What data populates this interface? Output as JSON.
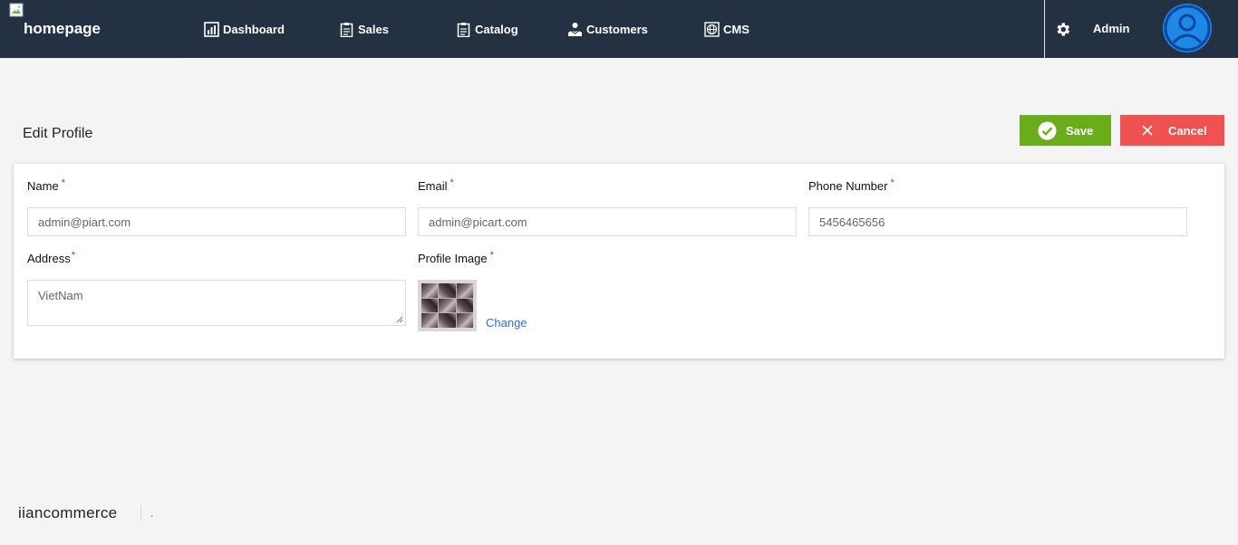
{
  "nav": {
    "brand": "homepage",
    "items": [
      {
        "label": "Dashboard",
        "icon": "dashboard-icon"
      },
      {
        "label": "Sales",
        "icon": "clipboard-icon"
      },
      {
        "label": "Catalog",
        "icon": "clipboard-icon"
      },
      {
        "label": "Customers",
        "icon": "customers-icon"
      },
      {
        "label": "CMS",
        "icon": "globe-icon"
      }
    ],
    "settings_icon": "gear-icon",
    "user_name": "Admin",
    "avatar_icon": "user-avatar-icon"
  },
  "page": {
    "title": "Edit Profile",
    "save_label": "Save",
    "cancel_label": "Cancel"
  },
  "form": {
    "name": {
      "label": "Name",
      "required": "*",
      "value": "admin@piart.com"
    },
    "email": {
      "label": "Email",
      "required": "*",
      "value": "admin@picart.com"
    },
    "phone": {
      "label": "Phone Number",
      "required": "*",
      "value": "5456465656"
    },
    "address": {
      "label": "Address",
      "required": "*",
      "value": "VietNam"
    },
    "profile_image": {
      "label": "Profile Image",
      "required": "*",
      "change_label": "Change"
    }
  },
  "footer": {
    "brand": "iiancommerce",
    "dot": "."
  },
  "colors": {
    "navbar": "#233142",
    "save": "#6aad1a",
    "cancel": "#f05151",
    "avatar": "#1e88e5",
    "link": "#2a6fdb"
  }
}
